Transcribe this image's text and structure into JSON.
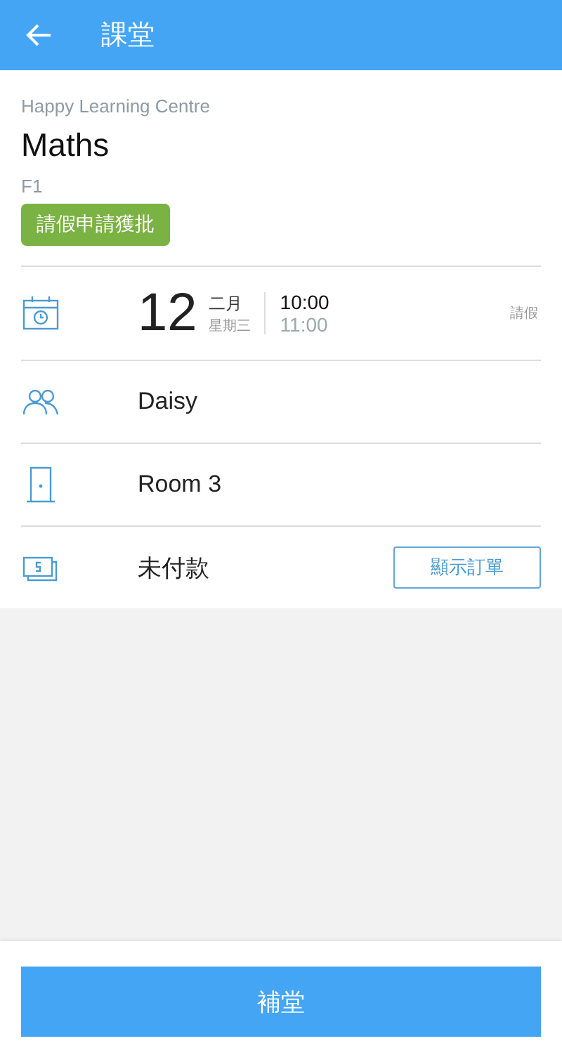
{
  "header": {
    "title": "課堂"
  },
  "lesson": {
    "centre": "Happy Learning Centre",
    "subject": "Maths",
    "grade": "F1",
    "status_badge": "請假申請獲批"
  },
  "rows": [
    {
      "kind": "date",
      "day": "12",
      "month": "二月",
      "weekday": "星期三",
      "start": "10:00",
      "end": "11:00",
      "action": "請假"
    },
    {
      "kind": "teacher",
      "text": "Daisy"
    },
    {
      "kind": "room",
      "text": "Room 3"
    },
    {
      "kind": "payment",
      "text": "未付款",
      "button": "顯示訂單"
    }
  ],
  "footer_button": "補堂"
}
